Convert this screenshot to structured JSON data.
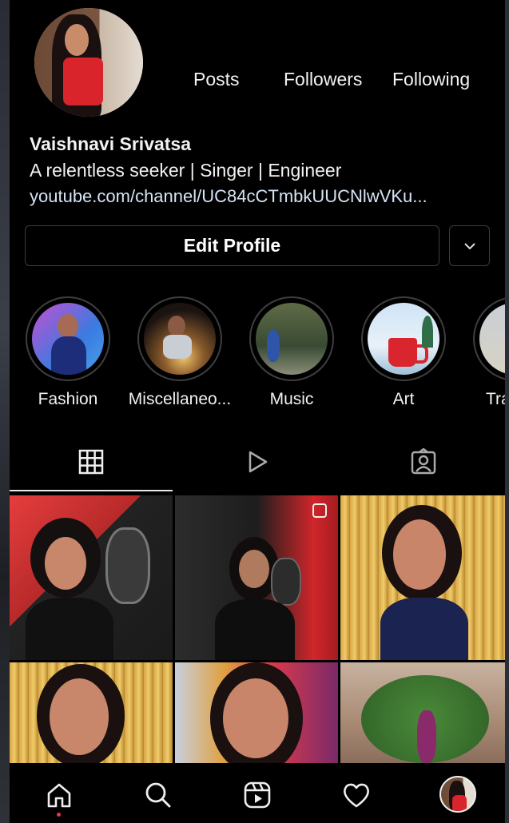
{
  "profile": {
    "stats": {
      "posts_label": "Posts",
      "followers_label": "Followers",
      "following_label": "Following"
    },
    "name": "Vaishnavi Srivatsa",
    "bio": "A relentless seeker | Singer | Engineer",
    "link": "youtube.com/channel/UC84cCTmbkUUCNlwVKu..."
  },
  "buttons": {
    "edit_profile": "Edit Profile"
  },
  "highlights": [
    {
      "label": "Fashion"
    },
    {
      "label": "Miscellaneo..."
    },
    {
      "label": "Music"
    },
    {
      "label": "Art"
    },
    {
      "label": "Tra"
    }
  ],
  "tabs": [
    "grid-icon",
    "reels-play-icon",
    "tagged-icon"
  ],
  "bottom_nav": [
    "home-icon",
    "search-icon",
    "reels-icon",
    "heart-icon",
    "profile-avatar"
  ],
  "colors": {
    "background": "#000000",
    "text": "#f2f2f2",
    "link": "#d6e4f5",
    "notification_dot": "#e33b4d"
  }
}
